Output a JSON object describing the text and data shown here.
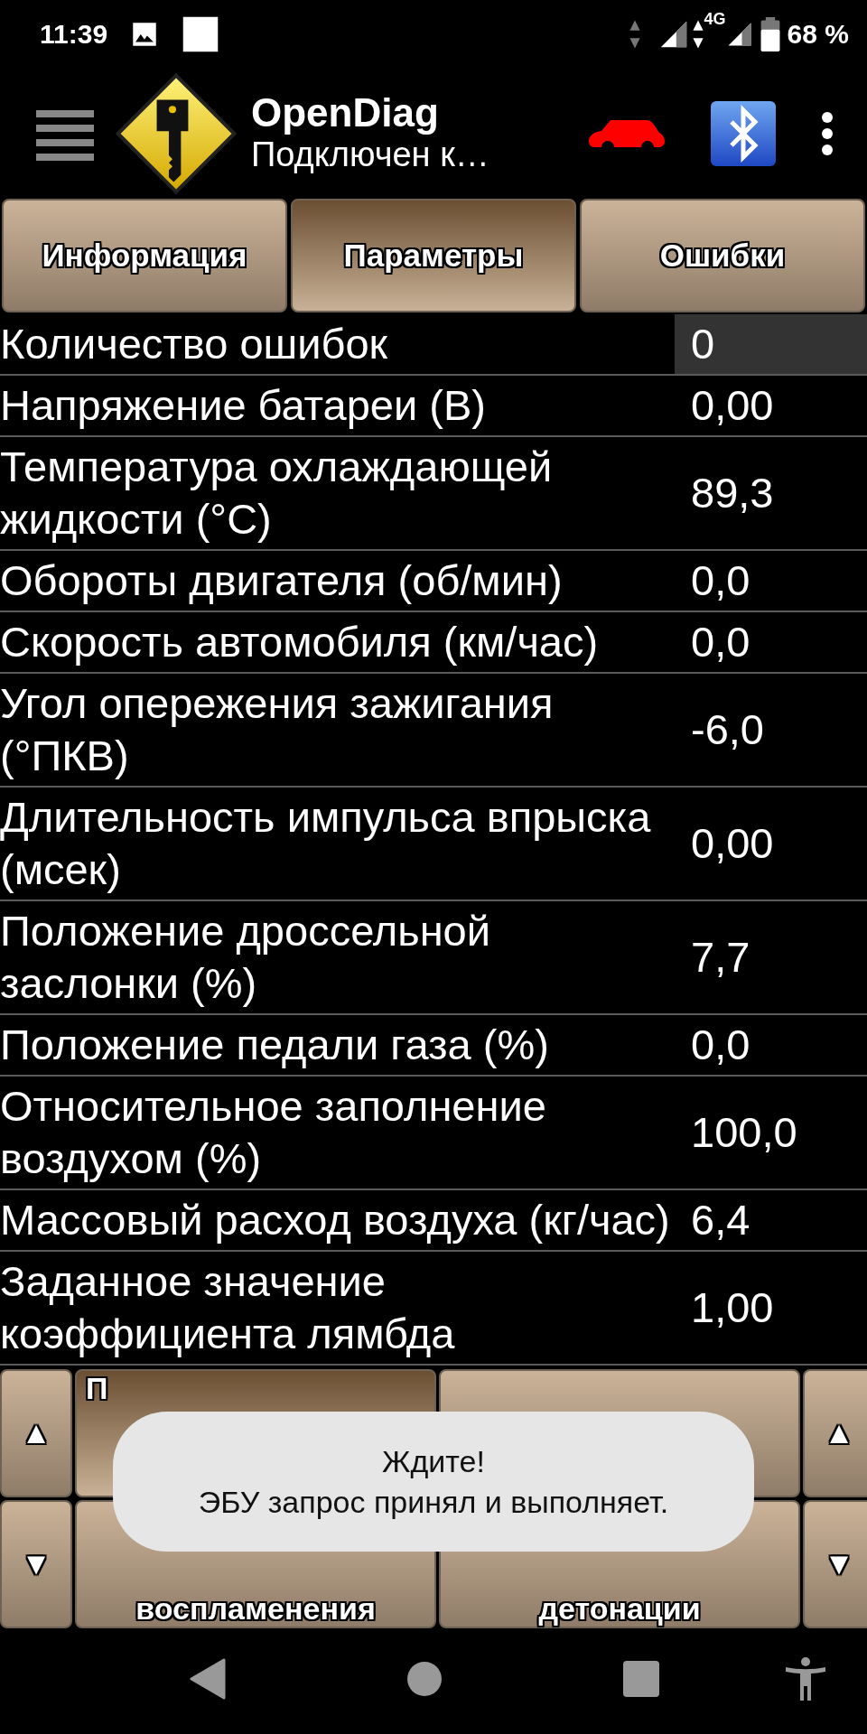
{
  "status_bar": {
    "time": "11:39",
    "network": "4G",
    "battery": "68 %"
  },
  "toolbar": {
    "title": "OpenDiag",
    "subtitle": "Подключен к…"
  },
  "tabs": [
    {
      "label": "Информация",
      "selected": false
    },
    {
      "label": "Параметры",
      "selected": true
    },
    {
      "label": "Ошибки",
      "selected": false
    }
  ],
  "parameters": [
    {
      "label": "Количество ошибок",
      "value": "0",
      "selected": true
    },
    {
      "label": "Напряжение батареи (В)",
      "value": "0,00",
      "selected": false
    },
    {
      "label": "Температура охлаждающей жидкости (°С)",
      "value": "89,3",
      "selected": false
    },
    {
      "label": "Обороты двигателя (об/мин)",
      "value": "0,0",
      "selected": false
    },
    {
      "label": "Скорость автомобиля (км/час)",
      "value": "0,0",
      "selected": false
    },
    {
      "label": "Угол опережения зажигания (°ПКВ)",
      "value": "-6,0",
      "selected": false
    },
    {
      "label": "Длительность импульса впрыска (мсек)",
      "value": "0,00",
      "selected": false
    },
    {
      "label": "Положение дроссельной заслонки (%)",
      "value": "7,7",
      "selected": false
    },
    {
      "label": "Положение педали газа (%)",
      "value": "0,0",
      "selected": false
    },
    {
      "label": "Относительное заполнение воздухом (%)",
      "value": "100,0",
      "selected": false
    },
    {
      "label": "Массовый расход воздуха (кг/час)",
      "value": "6,4",
      "selected": false
    },
    {
      "label": "Заданное значение коэффициента лямбда",
      "value": "1,00",
      "selected": false
    }
  ],
  "bottom_panel": {
    "left_arrows": [
      "▲",
      "▼"
    ],
    "right_arrows": [
      "▲",
      "▼"
    ],
    "buttons": [
      {
        "label": "П",
        "selected": true
      },
      {
        "selected": false
      },
      {
        "label": "воспламенения",
        "selected": false
      },
      {
        "label": "детонации",
        "selected": false
      }
    ]
  },
  "toast": {
    "lines": [
      "Ждите!",
      "ЭБУ запрос принял и выполняет."
    ]
  }
}
